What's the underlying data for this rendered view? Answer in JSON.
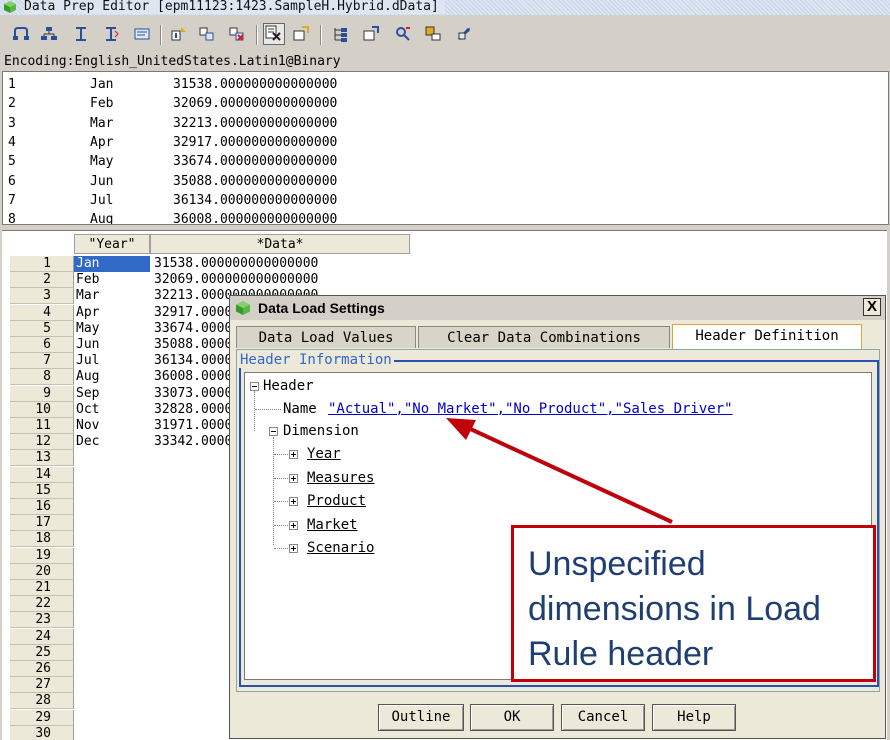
{
  "window": {
    "title": "Data Prep Editor [epm11123:1423.SampleH.Hybrid.dData]",
    "app_icon": "cube-icon"
  },
  "toolbar": {
    "buttons": [
      {
        "icon": "open-icon"
      },
      {
        "icon": "tree-icon"
      },
      {
        "icon": "sort-icon"
      },
      {
        "icon": "sort-desc-icon"
      },
      {
        "icon": "view-icon"
      },
      {
        "icon": "join-icon"
      },
      {
        "icon": "split-icon"
      },
      {
        "icon": "delete-icon"
      },
      {
        "icon": "data-load-settings-icon"
      },
      {
        "icon": "field-properties-icon"
      },
      {
        "icon": "dimension-build-icon"
      },
      {
        "icon": "move-field-icon"
      },
      {
        "icon": "validate-icon"
      },
      {
        "icon": "associate-icon"
      },
      {
        "icon": "refresh-icon"
      }
    ]
  },
  "encoding": "Encoding:English_UnitedStates.Latin1@Binary",
  "raw_data": [
    {
      "n": "1",
      "month": "Jan",
      "value": "31538.000000000000000"
    },
    {
      "n": "2",
      "month": "Feb",
      "value": "32069.000000000000000"
    },
    {
      "n": "3",
      "month": "Mar",
      "value": "32213.000000000000000"
    },
    {
      "n": "4",
      "month": "Apr",
      "value": "32917.000000000000000"
    },
    {
      "n": "5",
      "month": "May",
      "value": "33674.000000000000000"
    },
    {
      "n": "6",
      "month": "Jun",
      "value": "35088.000000000000000"
    },
    {
      "n": "7",
      "month": "Jul",
      "value": "36134.000000000000000"
    },
    {
      "n": "8",
      "month": "Aug",
      "value": "36008.000000000000000"
    }
  ],
  "grid": {
    "headers": [
      "\"Year\"",
      "*Data*"
    ],
    "rows": [
      {
        "year": "Jan",
        "data": "31538.000000000000000"
      },
      {
        "year": "Feb",
        "data": "32069.000000000000000"
      },
      {
        "year": "Mar",
        "data": "32213.000000000000000"
      },
      {
        "year": "Apr",
        "data": "32917.000000000000000"
      },
      {
        "year": "May",
        "data": "33674.000000000000000"
      },
      {
        "year": "Jun",
        "data": "35088.000000000000000"
      },
      {
        "year": "Jul",
        "data": "36134.000000000000000"
      },
      {
        "year": "Aug",
        "data": "36008.000000000000000"
      },
      {
        "year": "Sep",
        "data": "33073.000000000000000"
      },
      {
        "year": "Oct",
        "data": "32828.000000000000000"
      },
      {
        "year": "Nov",
        "data": "31971.000000000000000"
      },
      {
        "year": "Dec",
        "data": "33342.000000000000000"
      }
    ],
    "row_numbers": [
      "1",
      "2",
      "3",
      "4",
      "5",
      "6",
      "7",
      "8",
      "9",
      "10",
      "11",
      "12",
      "13",
      "14",
      "15",
      "16",
      "17",
      "18",
      "19",
      "20",
      "21",
      "22",
      "23",
      "24",
      "25",
      "26",
      "27",
      "28",
      "29",
      "30"
    ]
  },
  "dialog": {
    "title": "Data Load Settings",
    "close": "X",
    "tabs": [
      "Data Load Values",
      "Clear Data Combinations",
      "Header Definition"
    ],
    "active_tab": "Header Definition",
    "group_label": "Header Information",
    "tree": {
      "root": "Header",
      "name_label": "Name",
      "name_value": "\"Actual\",\"No Market\",\"No Product\",\"Sales Driver\"",
      "dimension_label": "Dimension",
      "dimensions": [
        "Year",
        "Measures",
        "Product",
        "Market",
        "Scenario"
      ]
    },
    "buttons": [
      "Outline",
      "OK",
      "Cancel",
      "Help"
    ]
  },
  "callout": {
    "text": "Unspecified dimensions in Load Rule header",
    "border_color": "#c0000a"
  }
}
